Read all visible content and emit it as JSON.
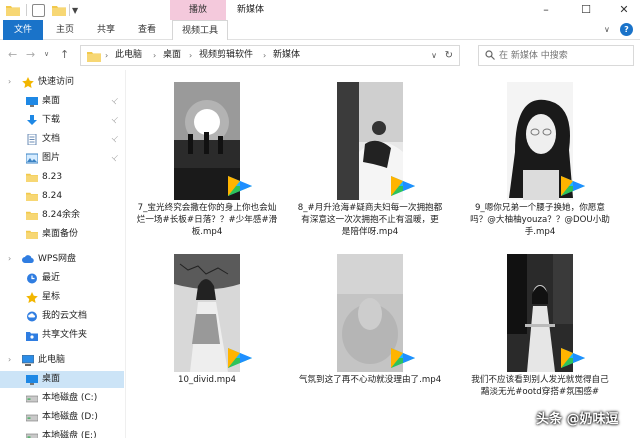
{
  "window": {
    "title": "新媒体",
    "context_tab": "播放",
    "tabs": [
      {
        "label": "文件"
      },
      {
        "label": "主页"
      },
      {
        "label": "共享"
      },
      {
        "label": "查看"
      },
      {
        "label": "视频工具"
      }
    ]
  },
  "address": {
    "crumbs": [
      "此电脑",
      "桌面",
      "视频剪辑软件",
      "新媒体"
    ],
    "search_placeholder": "在 新媒体 中搜索"
  },
  "sidebar": {
    "items": [
      {
        "label": "快速访问",
        "icon": "star-icon",
        "indent": 0
      },
      {
        "label": "桌面",
        "icon": "desktop-icon",
        "indent": 1,
        "pinned": true
      },
      {
        "label": "下载",
        "icon": "download-icon",
        "indent": 1,
        "pinned": true
      },
      {
        "label": "文档",
        "icon": "document-icon",
        "indent": 1,
        "pinned": true
      },
      {
        "label": "图片",
        "icon": "picture-icon",
        "indent": 1,
        "pinned": true
      },
      {
        "label": "8.23",
        "icon": "folder-icon",
        "indent": 1
      },
      {
        "label": "8.24",
        "icon": "folder-icon",
        "indent": 1
      },
      {
        "label": "8.24余余",
        "icon": "folder-icon",
        "indent": 1
      },
      {
        "label": "桌面备份",
        "icon": "folder-icon",
        "indent": 1
      },
      {
        "label": "WPS网盘",
        "icon": "cloud-icon",
        "indent": 0
      },
      {
        "label": "最近",
        "icon": "clock-icon",
        "indent": 1
      },
      {
        "label": "星标",
        "icon": "star-icon",
        "indent": 1
      },
      {
        "label": "我的云文档",
        "icon": "cloud-doc-icon",
        "indent": 1
      },
      {
        "label": "共享文件夹",
        "icon": "share-folder-icon",
        "indent": 1
      },
      {
        "label": "此电脑",
        "icon": "computer-icon",
        "indent": 0
      },
      {
        "label": "桌面",
        "icon": "desktop-icon",
        "indent": 1,
        "selected": true
      },
      {
        "label": "本地磁盘 (C:)",
        "icon": "drive-icon",
        "indent": 1
      },
      {
        "label": "本地磁盘 (D:)",
        "icon": "drive-icon",
        "indent": 1
      },
      {
        "label": "本地磁盘 (E:)",
        "icon": "drive-icon",
        "indent": 1
      }
    ]
  },
  "files": [
    {
      "name": "7_宝光终究会撒在你的身上你也会灿烂一场#长板#日落？？#少年感#滑板.mp4",
      "thumb": "sunset"
    },
    {
      "name": "8_#月升沧海#疑商夫妇每一次拥抱都有深意这一次次拥抱不止有温暖，更是陪伴呀.mp4",
      "thumb": "couple"
    },
    {
      "name": "9_嗯你兄弟一个腰子换她，你愿意吗？@大柚柚youza？？@DOU小助手.mp4",
      "thumb": "portrait"
    },
    {
      "name": "10_divid.mp4",
      "thumb": "hanfu"
    },
    {
      "name": "气氛到这了再不心动就没理由了.mp4",
      "thumb": "blur"
    },
    {
      "name": "我们不应该看到别人发光就觉得自己黯淡无光#ootd穿搭#氛围感#",
      "thumb": "street"
    }
  ],
  "watermark": "头条 @奶味逗"
}
